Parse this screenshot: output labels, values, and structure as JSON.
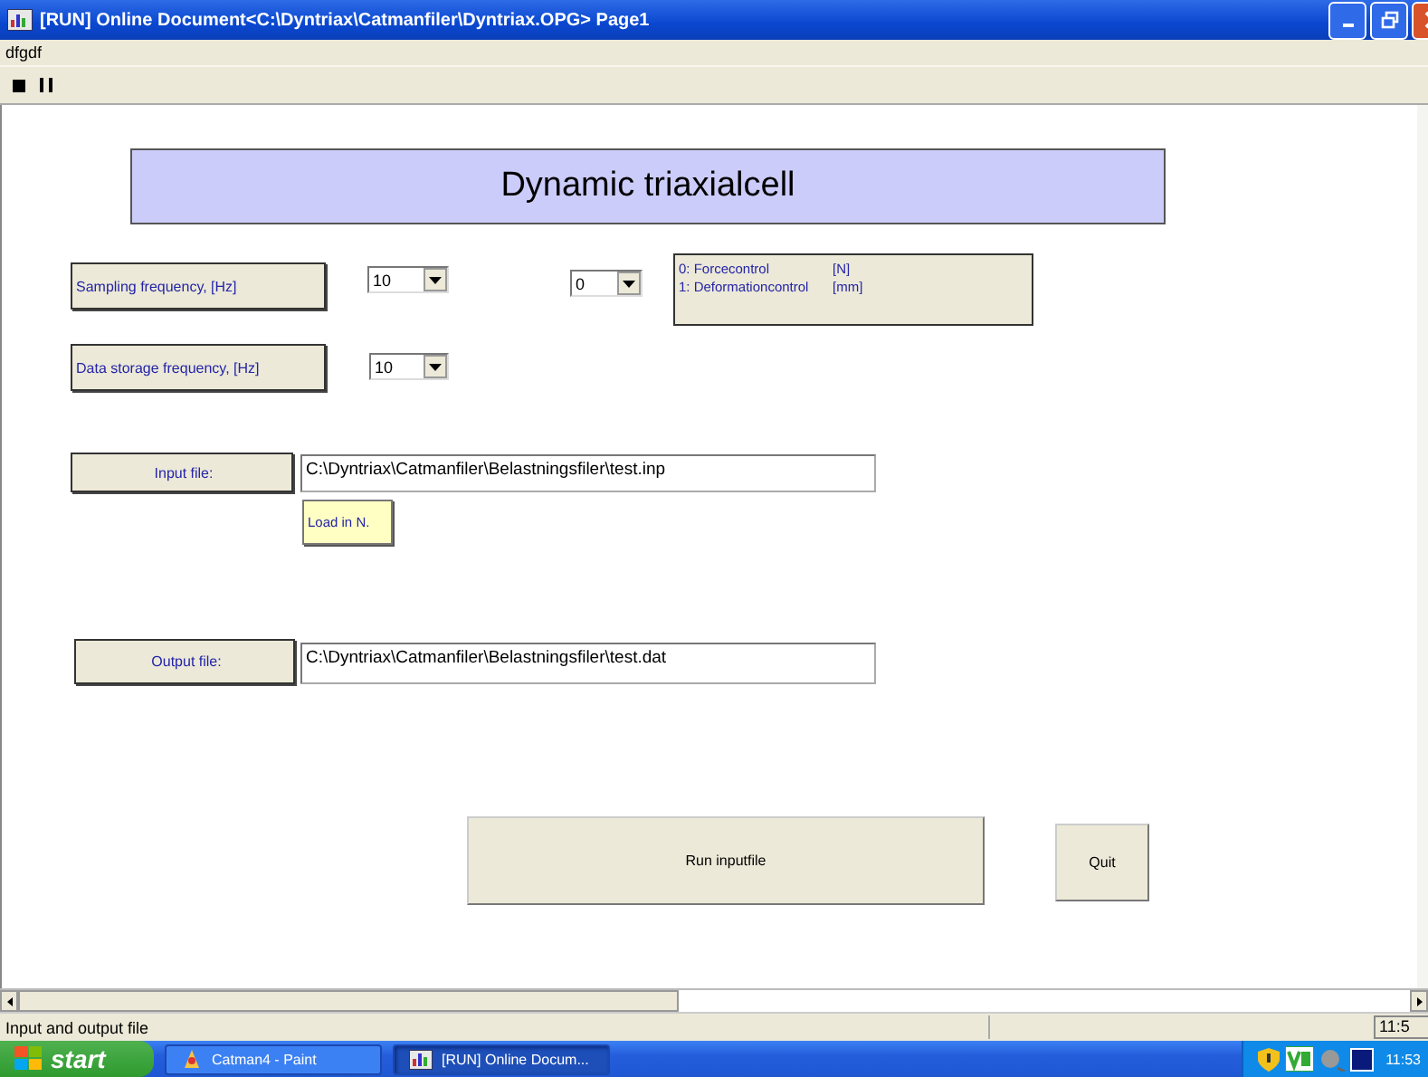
{
  "window": {
    "title": "[RUN]  Online Document<C:\\Dyntriax\\Catmanfiler\\Dyntriax.OPG>  Page1"
  },
  "menu": [
    "dfgdf"
  ],
  "toolbar": [
    {
      "kind": "stop"
    },
    {
      "kind": "pause"
    }
  ],
  "document": {
    "banner": "Dynamic triaxialcell",
    "sampling": {
      "label": "Sampling frequency, [Hz]",
      "value": "10"
    },
    "mode": {
      "value": "0",
      "legend": [
        {
          "text": "0: Forcecontrol",
          "unit": "[N]"
        },
        {
          "text": "1: Deformationcontrol",
          "unit": "[mm]"
        }
      ]
    },
    "storage": {
      "label": "Data storage frequency, [Hz]",
      "value": "10"
    },
    "input": {
      "label": "Input file:",
      "value": "C:\\Dyntriax\\Catmanfiler\\Belastningsfiler\\test.inp",
      "note": "Load in N."
    },
    "output": {
      "label": "Output file:",
      "value": "C:\\Dyntriax\\Catmanfiler\\Belastningsfiler\\test.dat"
    },
    "buttons": [
      "Run inputfile",
      "Quit"
    ]
  },
  "status_bar": {
    "message": "Input and output file",
    "clock": "11:5"
  },
  "taskbar": {
    "start": "start",
    "tasks": [
      {
        "label": "Catman4 - Paint",
        "kind": "paint",
        "selected": false
      },
      {
        "label": "[RUN]  Online Docum...",
        "kind": "app",
        "selected": true
      }
    ],
    "clock": "11:53"
  }
}
